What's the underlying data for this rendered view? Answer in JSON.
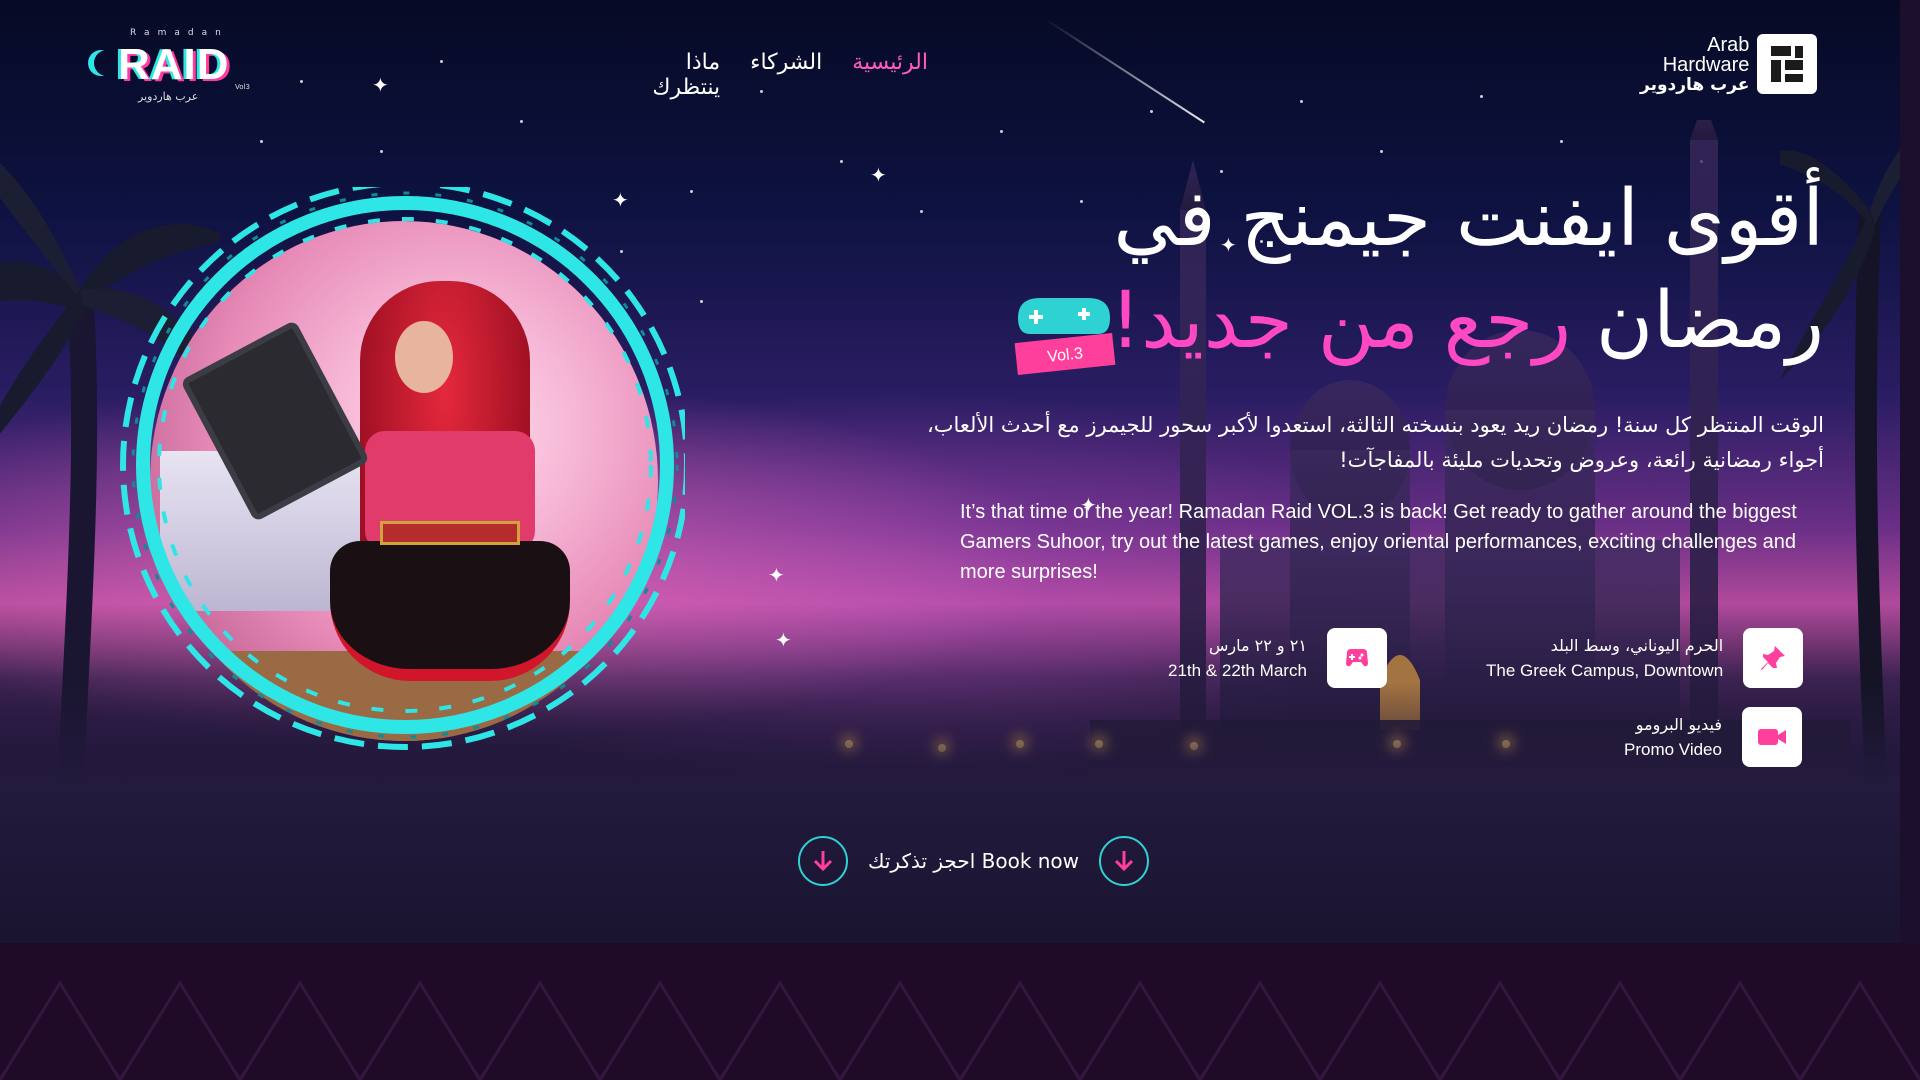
{
  "brand": {
    "raid_small": "Ramadan",
    "raid_big": "RAID",
    "raid_arabic": "عرب هاردوير",
    "raid_vol": "Vol3",
    "ah_en_line1": "Arab",
    "ah_en_line2": "Hardware",
    "ah_ar": "عرب هاردوير"
  },
  "nav": {
    "items": [
      {
        "label": "الرئيسية",
        "active": true
      },
      {
        "label": "الشركاء",
        "active": false
      },
      {
        "label": "ماذا ينتظرك",
        "active": false
      }
    ]
  },
  "hero": {
    "headline_line1": "أقوى ايفنت جيمنج في",
    "headline_line2_white": "رمضان",
    "headline_line2_pink": "رجع من جديد!",
    "vol_badge": "Vol.3",
    "desc_ar_line1": "الوقت المنتظر كل سنة! رمضان ريد يعود بنسخته الثالثة، استعدوا لأكبر سحور للجيمرز مع أحدث الألعاب،",
    "desc_ar_line2": "أجواء رمضانية رائعة، وعروض وتحديات مليئة بالمفاجآت!",
    "desc_en": "It’s that time of the year! Ramadan Raid VOL.3 is back! Get ready to gather around the biggest Gamers Suhoor, try out the latest games, enjoy oriental performances, exciting challenges and more surprises!"
  },
  "info": {
    "location_ar": "الحرم اليوناني، وسط البلد",
    "location_en": "The Greek Campus, Downtown",
    "date_ar": "٢١ و ٢٢ مارس",
    "date_en": "21th & 22th March",
    "promo_ar": "فيديو البرومو",
    "promo_en": "Promo Video"
  },
  "cta": {
    "label": "احجز تذكرتك Book now"
  },
  "colors": {
    "accent_pink": "#ff48c4",
    "accent_cyan": "#2ed2d2",
    "icon_pink": "#ff3f9c"
  }
}
